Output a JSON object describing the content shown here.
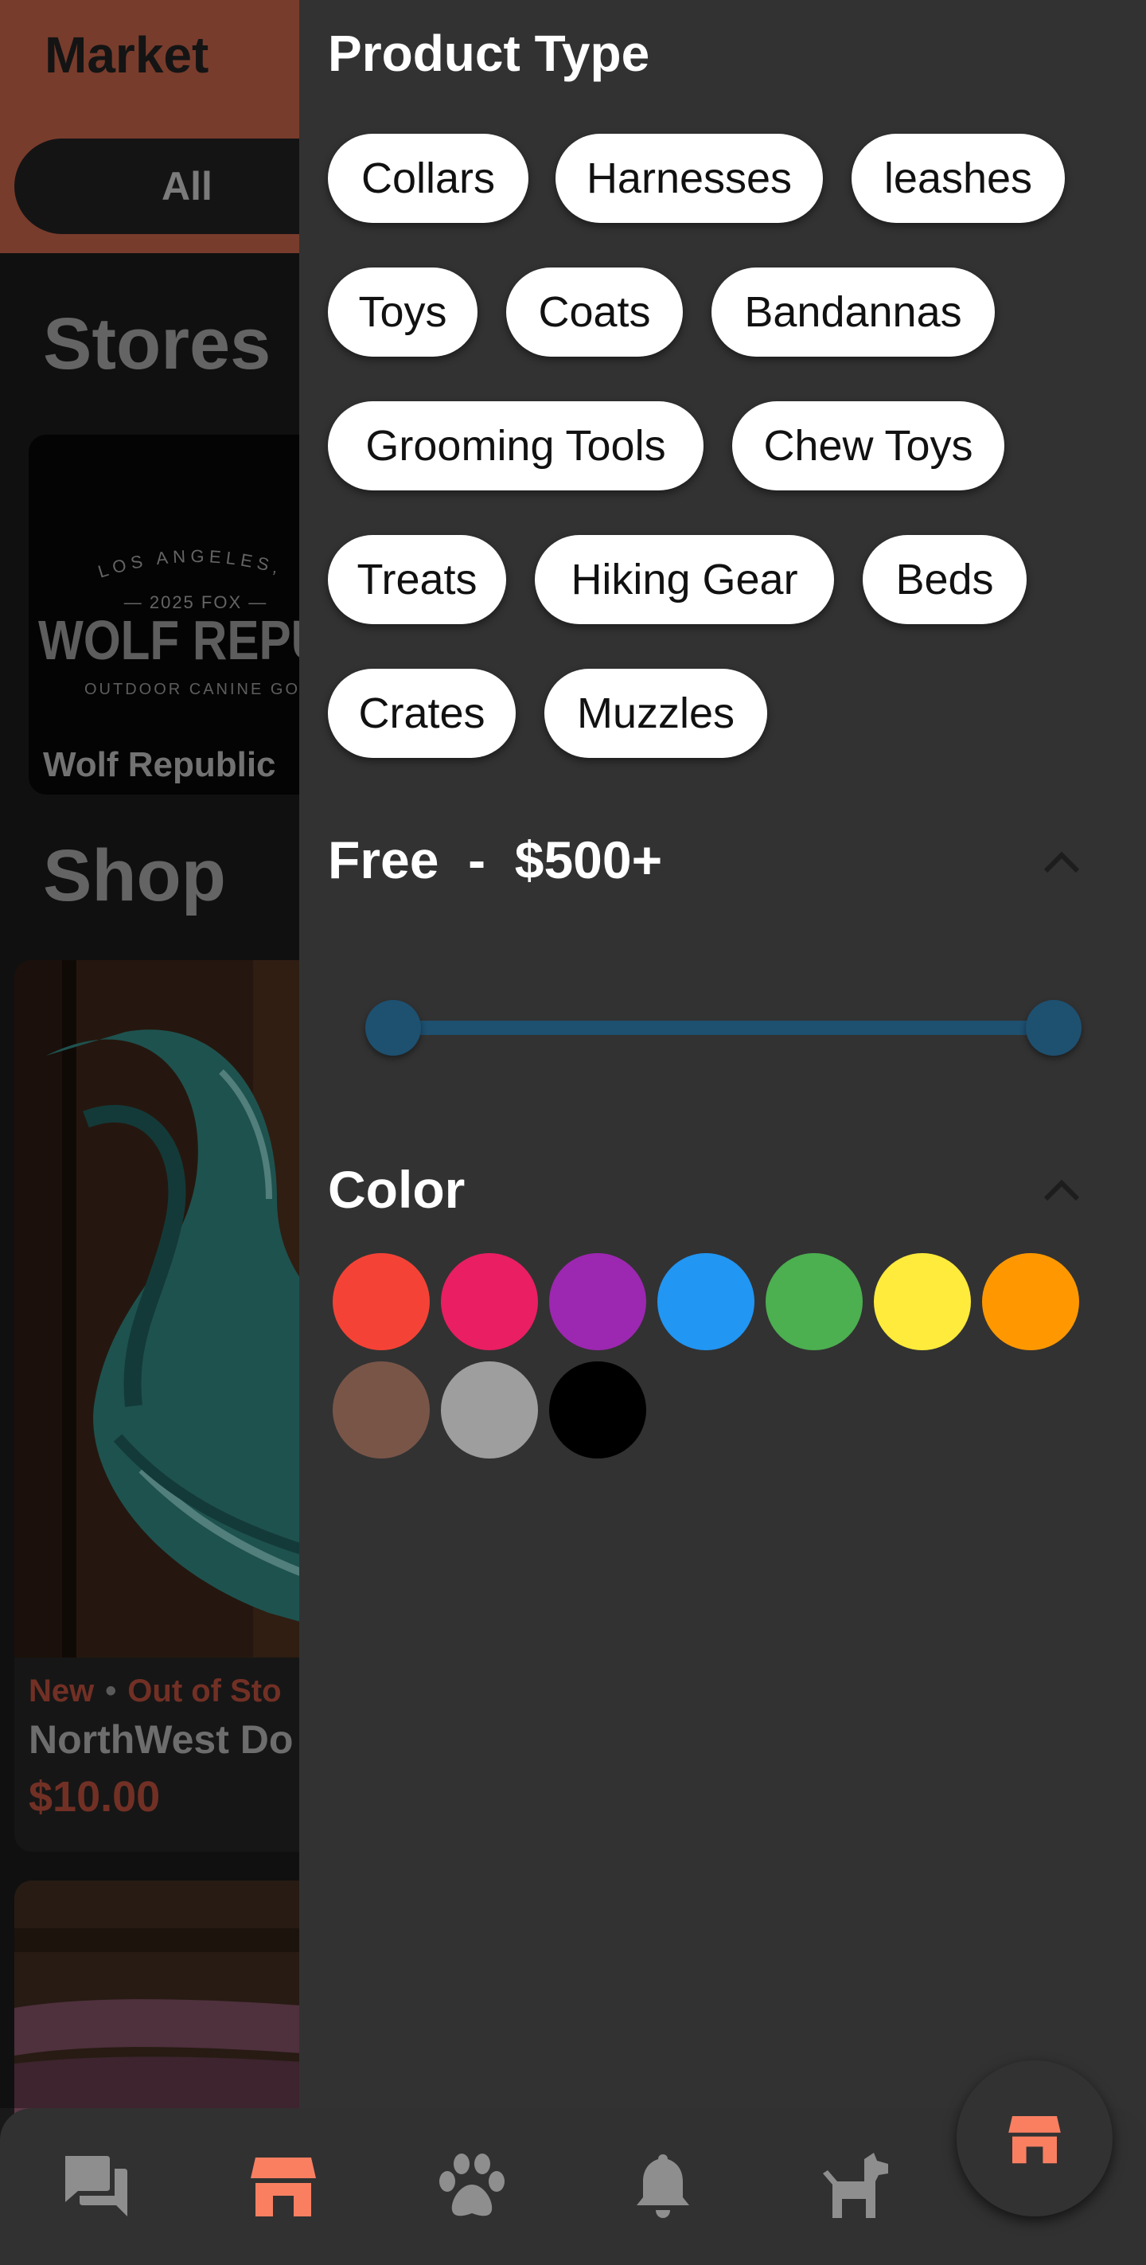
{
  "market": {
    "title": "Market",
    "filter_all": "All",
    "stores_heading": "Stores",
    "shop_heading": "Shop"
  },
  "store": {
    "name": "Wolf Republic",
    "logo_top": "LOS ANGELES, C",
    "logo_sub": "— 2025 FOX —",
    "logo_main": "WOLF REPUB",
    "logo_tag": "OUTDOOR CANINE GOO"
  },
  "product": {
    "tag_new": "New",
    "tag_stock": "Out of Sto",
    "name": "NorthWest Do",
    "price": "$10.00"
  },
  "filters": {
    "product_type_title": "Product Type",
    "chips": [
      "Collars",
      "Harnesses",
      "leashes",
      "Toys",
      "Coats",
      "Bandannas",
      "Grooming Tools",
      "Chew Toys",
      "Treats",
      "Hiking Gear",
      "Beds",
      "Crates",
      "Muzzles"
    ],
    "price_label": "Free  -  $500+",
    "price_range": {
      "min_fraction": 0.0,
      "max_fraction": 1.0
    },
    "color_title": "Color",
    "colors": [
      "#f44336",
      "#e91e63",
      "#9c27b0",
      "#2196f3",
      "#4caf50",
      "#ffeb3b",
      "#ff9800",
      "#795548",
      "#9e9e9e",
      "#000000"
    ]
  },
  "nav": {
    "items": [
      "chat-icon",
      "store-icon",
      "paw-icon",
      "bell-icon",
      "dog-icon"
    ],
    "active": "store-icon",
    "active_color": "#fa7f61",
    "inactive_color": "#8e8e8e"
  }
}
